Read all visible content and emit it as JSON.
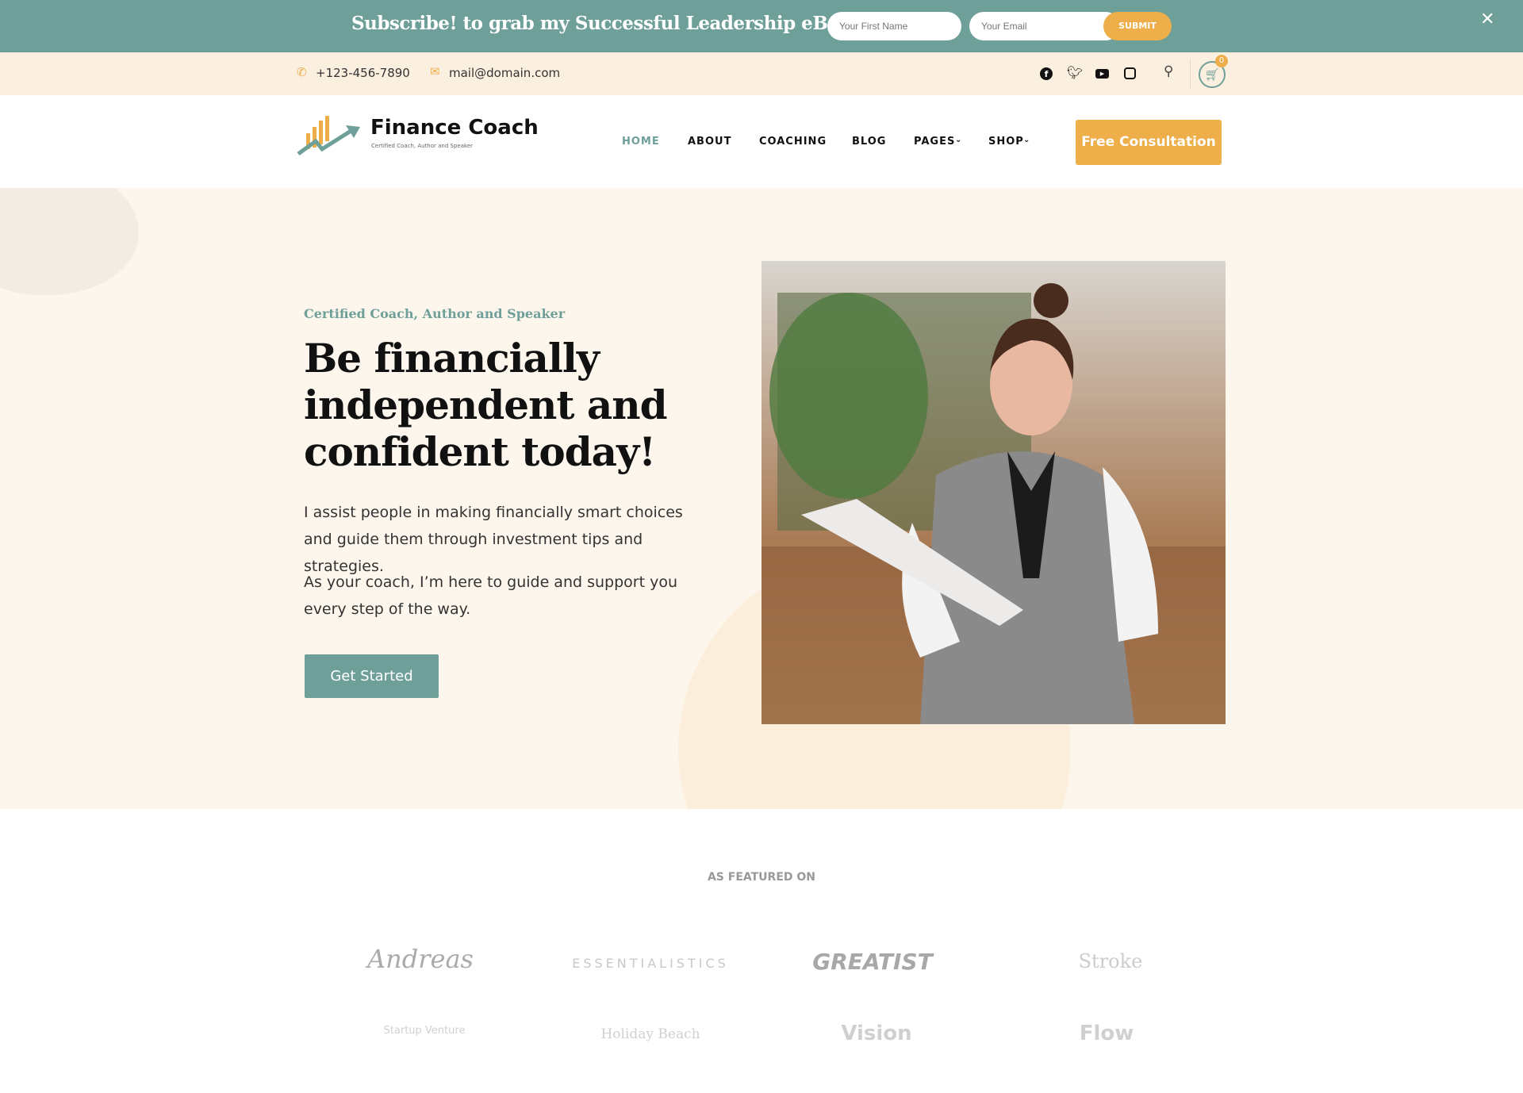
{
  "promo": {
    "title": "Subscribe! to grab my Successful Leadership eBook!",
    "first_name_placeholder": "Your First Name",
    "email_placeholder": "Your Email",
    "submit": "SUBMIT",
    "close": "✕"
  },
  "topbar": {
    "phone": "+123-456-7890",
    "email": "mail@domain.com",
    "social": [
      "facebook-icon",
      "twitter-icon",
      "youtube-icon",
      "instagram-icon"
    ],
    "cart_count": "0"
  },
  "header": {
    "brand": "Finance Coach",
    "tagline": "Certified Coach, Author and Speaker",
    "nav": [
      {
        "label": "HOME",
        "active": true
      },
      {
        "label": "ABOUT"
      },
      {
        "label": "COACHING"
      },
      {
        "label": "BLOG"
      },
      {
        "label": "PAGES",
        "dropdown": true
      },
      {
        "label": "SHOP",
        "dropdown": true
      }
    ],
    "cta": "Free Consultation"
  },
  "hero": {
    "eyebrow": "Certified Coach, Author and Speaker",
    "heading": [
      "Be financially",
      "independent and",
      "confident today!"
    ],
    "para1": "I assist people in making financially smart choices and guide them through investment tips and strategies.",
    "para2": "As your coach, I’m here to guide and support you every step of the way.",
    "button": "Get Started"
  },
  "featured": {
    "title": "AS FEATURED ON",
    "logos": [
      "Andreas",
      "ESSENTIALISTICS",
      "GREATIST",
      "Stroke",
      "Startup Venture",
      "Holiday Beach",
      "Vision",
      "Flow"
    ]
  },
  "colors": {
    "teal": "#6f9f99",
    "orange": "#eeae4a",
    "cream": "#fbefdf"
  }
}
